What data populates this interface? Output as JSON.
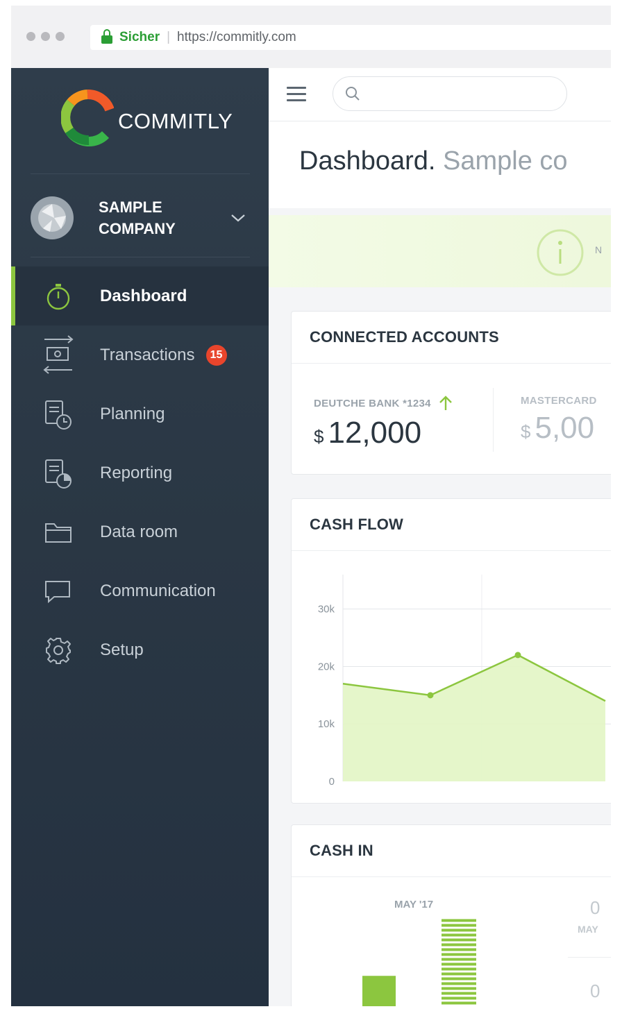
{
  "browser": {
    "secure_label": "Sicher",
    "url": "https://commitly.com"
  },
  "sidebar": {
    "brand": "COMMITLY",
    "company": "SAMPLE COMPANY",
    "items": [
      {
        "label": "Dashboard",
        "icon": "stopwatch-icon",
        "active": true
      },
      {
        "label": "Transactions",
        "icon": "transactions-icon",
        "badge": "15"
      },
      {
        "label": "Planning",
        "icon": "planning-icon"
      },
      {
        "label": "Reporting",
        "icon": "reporting-icon"
      },
      {
        "label": "Data room",
        "icon": "folder-icon"
      },
      {
        "label": "Communication",
        "icon": "chat-icon"
      },
      {
        "label": "Setup",
        "icon": "gear-icon"
      }
    ]
  },
  "header": {
    "title": "Dashboard.",
    "subtitle": "Sample co",
    "notice_text": "N"
  },
  "accounts": {
    "title": "CONNECTED ACCOUNTS",
    "items": [
      {
        "label": "DEUTCHE BANK *1234",
        "currency": "$",
        "amount": "12,000",
        "trend": "up"
      },
      {
        "label": "MASTERCARD",
        "currency": "$",
        "amount": "5,00"
      }
    ]
  },
  "cashflow": {
    "title": "CASH FLOW"
  },
  "cashin": {
    "title": "CASH IN",
    "month_label": "MAY '17",
    "right_labels": [
      "0",
      "MAY",
      "0"
    ]
  },
  "colors": {
    "accent": "#8cc63f",
    "sidebar_bg": "#2f3d4b",
    "badge": "#e8452c",
    "secure": "#2b9e35"
  },
  "chart_data": [
    {
      "type": "area",
      "title": "CASH FLOW",
      "x": [
        0,
        1,
        2,
        3
      ],
      "series": [
        {
          "values": [
            17000,
            15000,
            22000,
            14000
          ]
        }
      ],
      "yticks": [
        "0",
        "10k",
        "20k",
        "30k"
      ],
      "ylim": [
        0,
        36000
      ],
      "grid": true
    },
    {
      "type": "bar",
      "title": "CASH IN",
      "categories": [
        "MAY '17"
      ],
      "series": [
        {
          "values": [
            8000
          ]
        },
        {
          "values": [
            16000
          ]
        }
      ],
      "ylim": [
        0,
        18000
      ]
    }
  ]
}
